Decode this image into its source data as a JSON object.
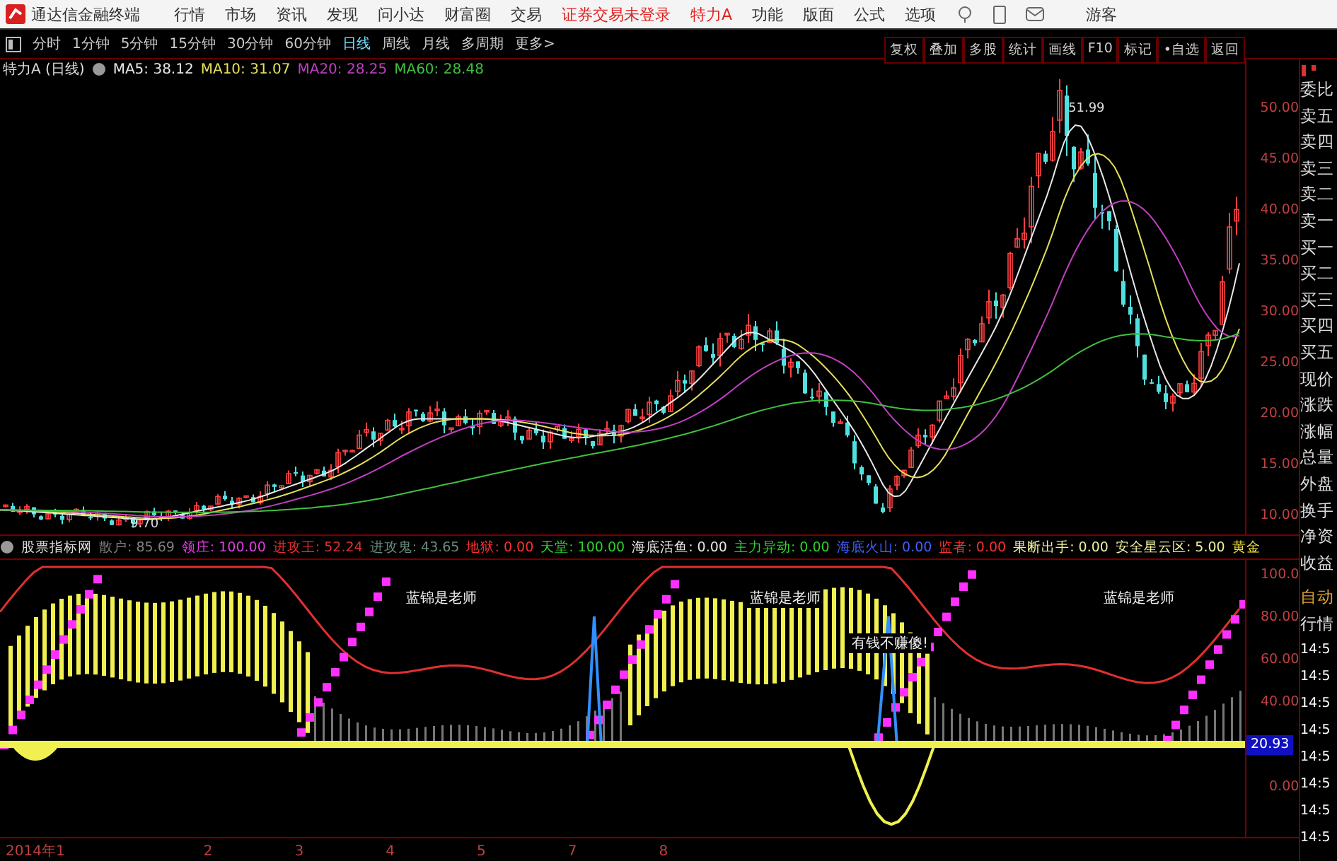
{
  "menubar": {
    "app_title": "通达信金融终端",
    "menus": [
      "行情",
      "市场",
      "资讯",
      "发现",
      "问小达",
      "财富圈",
      "交易"
    ],
    "status": "证券交易未登录",
    "stock": "特力A",
    "tools": [
      "功能",
      "版面",
      "公式",
      "选项"
    ],
    "user": "游客"
  },
  "periods": [
    {
      "label": "分时",
      "selected": false
    },
    {
      "label": "1分钟",
      "selected": false
    },
    {
      "label": "5分钟",
      "selected": false
    },
    {
      "label": "15分钟",
      "selected": false
    },
    {
      "label": "30分钟",
      "selected": false
    },
    {
      "label": "60分钟",
      "selected": false
    },
    {
      "label": "日线",
      "selected": true
    },
    {
      "label": "周线",
      "selected": false
    },
    {
      "label": "月线",
      "selected": false
    },
    {
      "label": "多周期",
      "selected": false
    },
    {
      "label": "更多>",
      "selected": false
    }
  ],
  "chart_tools": [
    "复权",
    "叠加",
    "多股",
    "统计",
    "画线",
    "F10",
    "标记",
    "•自选",
    "返回"
  ],
  "chart_header": {
    "title": "特力A (日线)",
    "mas": [
      {
        "label": "MA5: 38.12",
        "color": "#e8e8e8"
      },
      {
        "label": "MA10: 31.07",
        "color": "#e6e05a"
      },
      {
        "label": "MA20: 28.25",
        "color": "#c040c0"
      },
      {
        "label": "MA60: 28.48",
        "color": "#40c040"
      }
    ]
  },
  "price_axis": [
    "50.00",
    "45.00",
    "40.00",
    "35.00",
    "30.00",
    "25.00",
    "20.00",
    "15.00",
    "10.00"
  ],
  "price_marks": {
    "high": "51.99",
    "low": "9.70"
  },
  "indicator_header": {
    "title": "股票指标网",
    "items": [
      {
        "text": "散户: 85.69",
        "color": "#808080"
      },
      {
        "text": "领庄: 100.00",
        "color": "#e040e0"
      },
      {
        "text": "进攻王: 52.24",
        "color": "#e03030"
      },
      {
        "text": "进攻鬼: 43.65",
        "color": "#6a8a7a"
      },
      {
        "text": "地狱: 0.00",
        "color": "#ff3030"
      },
      {
        "text": "天堂: 100.00",
        "color": "#30d030"
      },
      {
        "text": "海底活鱼: 0.00",
        "color": "#e8e8e8"
      },
      {
        "text": "主力异动: 0.00",
        "color": "#30d030"
      },
      {
        "text": "海底火山: 0.00",
        "color": "#4060ff"
      },
      {
        "text": "监者: 0.00",
        "color": "#ff3030"
      },
      {
        "text": "果断出手: 0.00",
        "color": "#f0f0a0"
      },
      {
        "text": "安全星云区: 5.00",
        "color": "#f0f0a0"
      },
      {
        "text": "黄金",
        "color": "#f0e040"
      }
    ]
  },
  "annotations": [
    {
      "text": "蓝锦是老师",
      "kind": "label"
    },
    {
      "text": "蓝锦是老师",
      "kind": "label"
    },
    {
      "text": "有钱不赚傻!",
      "kind": "label"
    },
    {
      "text": "蓝锦是老师",
      "kind": "label"
    }
  ],
  "indicator_axis": [
    "100.0",
    "80.00",
    "60.00",
    "40.00",
    "0.00"
  ],
  "indicator_current": "20.93",
  "date_axis": [
    "2014年1",
    "2",
    "3",
    "4",
    "5",
    "7",
    "8"
  ],
  "quote_panel": {
    "fields": [
      "委比",
      "卖五",
      "卖四",
      "卖三",
      "卖二",
      "卖一",
      "买一",
      "买二",
      "买三",
      "买四",
      "买五",
      "现价",
      "涨跌",
      "涨幅",
      "总量",
      "外盘",
      "换手",
      "净资",
      "收益"
    ],
    "mode": "自动",
    "section": "行情",
    "times": [
      "14:5",
      "14:5",
      "14:5",
      "14:5",
      "14:5",
      "14:5",
      "14:5",
      "14:5"
    ]
  }
}
